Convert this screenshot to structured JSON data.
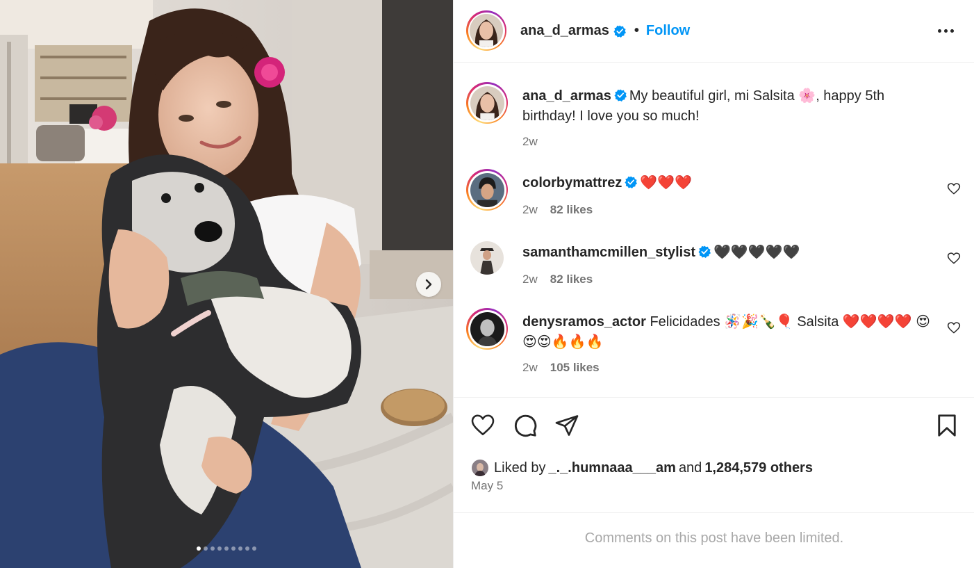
{
  "post": {
    "author": "ana_d_armas",
    "follow_label": "Follow",
    "separator": "•",
    "caption": "My beautiful girl, mi Salsita 🌸, happy 5th birthday! I love you so much!",
    "caption_time": "2w"
  },
  "carousel": {
    "total_slides": 9,
    "active_index": 0
  },
  "comments": [
    {
      "username": "colorbymattrez",
      "verified": true,
      "text": "❤️❤️❤️",
      "time": "2w",
      "likes": "82 likes"
    },
    {
      "username": "samanthamcmillen_stylist",
      "verified": true,
      "text": "🖤🖤🖤🖤🖤",
      "time": "2w",
      "likes": "82 likes"
    },
    {
      "username": "denysramos_actor",
      "verified": false,
      "text": "Felicidades 🪅🎉🍾🎈 Salsita ❤️❤️❤️❤️ 😍😍😍🔥🔥🔥",
      "time": "2w",
      "likes": "105 likes"
    }
  ],
  "likes": {
    "prefix": "Liked by",
    "user": "_._.humnaaa___am",
    "middle": "and",
    "count": "1,284,579 others"
  },
  "date": "May 5",
  "comments_limited": "Comments on this post have been limited.",
  "colors": {
    "accent": "#0095f6",
    "text": "#262626",
    "secondary": "#737373",
    "muted": "#a8a8a8",
    "border": "#efefef"
  },
  "icons": {
    "more": "more-horizontal-icon",
    "next": "chevron-right-icon",
    "like": "heart-outline-icon",
    "comment": "comment-bubble-icon",
    "share": "paper-plane-icon",
    "save": "bookmark-icon",
    "verified": "verified-badge-icon"
  }
}
